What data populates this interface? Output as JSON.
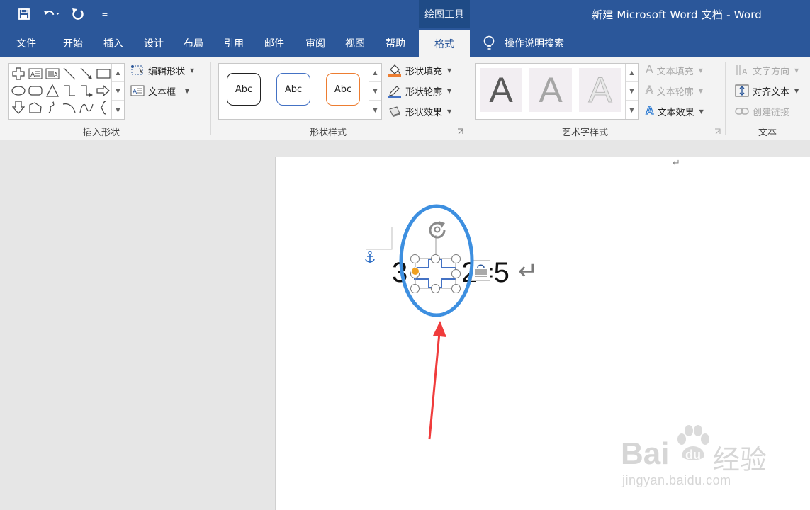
{
  "titlebar": {
    "contextual_label": "绘图工具",
    "doc_title": "新建 Microsoft Word 文档  -  Word",
    "qat_customize": "="
  },
  "tabs": [
    {
      "label": "文件"
    },
    {
      "label": "开始"
    },
    {
      "label": "插入"
    },
    {
      "label": "设计"
    },
    {
      "label": "布局"
    },
    {
      "label": "引用"
    },
    {
      "label": "邮件"
    },
    {
      "label": "审阅"
    },
    {
      "label": "视图"
    },
    {
      "label": "帮助"
    },
    {
      "label": "格式",
      "active": true
    }
  ],
  "tell_me": {
    "label": "操作说明搜索"
  },
  "ribbon": {
    "insert_shapes": {
      "label": "插入形状",
      "edit_shape": "编辑形状",
      "text_box": "文本框"
    },
    "shape_styles": {
      "label": "形状样式",
      "sample_text": "Abc",
      "fill": "形状填充",
      "outline": "形状轮廓",
      "effects": "形状效果",
      "sample_colors": [
        "#222222",
        "#4472c4",
        "#ed7d31"
      ]
    },
    "wordart_styles": {
      "label": "艺术字样式",
      "sample_letter": "A",
      "text_fill": "文本填充",
      "text_outline": "文本轮廓",
      "text_effects": "文本效果"
    },
    "text": {
      "label": "文本",
      "direction": "文字方向",
      "align": "对齐文本",
      "link": "创建链接"
    }
  },
  "document": {
    "eq_left": "3",
    "eq_right": "2=5",
    "return_mark": "↵"
  },
  "annotation": {
    "ellipse_color": "#3d8fe0",
    "arrow_color": "#f03c3c"
  },
  "watermark": {
    "brand_left": "Bai",
    "brand_paw": "du",
    "brand_cn": "经验",
    "url": "jingyan.baidu.com"
  },
  "colors": {
    "word_blue": "#2b579a",
    "ribbon_bg": "#f3f3f3"
  }
}
